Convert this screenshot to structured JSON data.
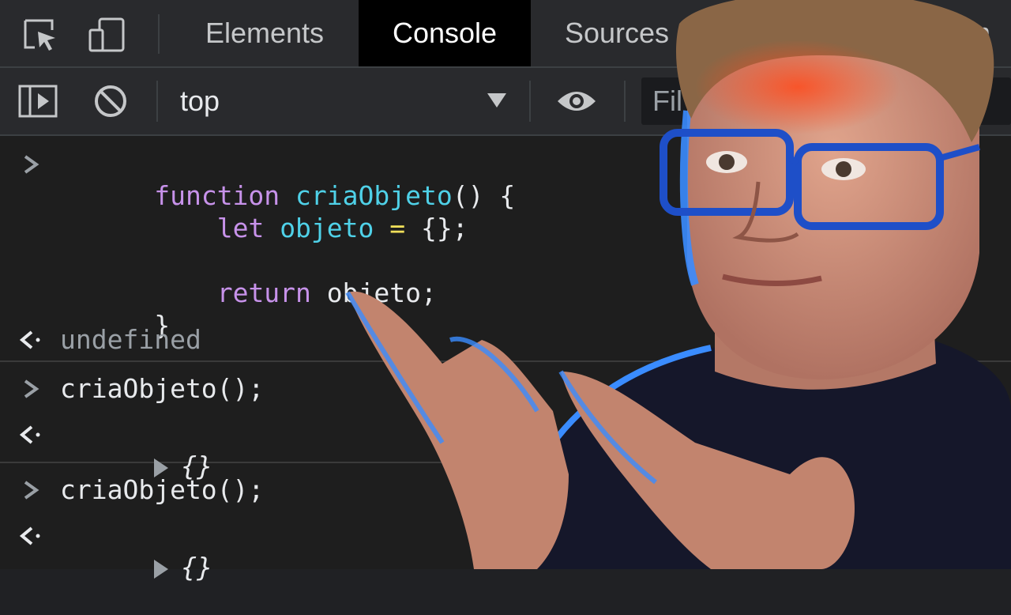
{
  "tabs": [
    {
      "label": "Elements"
    },
    {
      "label": "Console",
      "active": true
    },
    {
      "label": "Sources"
    },
    {
      "label": "rm"
    }
  ],
  "toolbar": {
    "context": "top",
    "filter_placeholder": "Fil"
  },
  "console": {
    "entries": [
      {
        "type": "input",
        "lines": [
          [
            {
              "t": "kw",
              "v": "function"
            },
            {
              "t": "pun",
              "v": " "
            },
            {
              "t": "fn",
              "v": "criaObjeto"
            },
            {
              "t": "pun",
              "v": "() {"
            }
          ],
          [
            {
              "t": "pun",
              "v": "    "
            },
            {
              "t": "kw",
              "v": "let"
            },
            {
              "t": "pun",
              "v": " "
            },
            {
              "t": "var",
              "v": "objeto"
            },
            {
              "t": "pun",
              "v": " "
            },
            {
              "t": "op",
              "v": "="
            },
            {
              "t": "pun",
              "v": " {};"
            }
          ],
          [],
          [
            {
              "t": "pun",
              "v": "    "
            },
            {
              "t": "kw",
              "v": "return"
            },
            {
              "t": "pun",
              "v": " objeto;"
            }
          ],
          [
            {
              "t": "pun",
              "v": "}"
            }
          ]
        ]
      },
      {
        "type": "output",
        "text": "undefined"
      },
      {
        "type": "input_single",
        "text": "criaObjeto();"
      },
      {
        "type": "output_obj",
        "text": "{}"
      },
      {
        "type": "input_single",
        "text": "criaObjeto();"
      },
      {
        "type": "output_obj",
        "text": "{}"
      }
    ]
  },
  "icons": [
    "inspect-element-icon",
    "device-toolbar-icon",
    "sidebar-toggle-icon",
    "clear-console-icon",
    "dropdown-caret-icon",
    "live-expression-eye-icon",
    "prompt-chevron-icon",
    "result-arrow-icon"
  ],
  "colors": {
    "keyword": "#c792ea",
    "identifier": "#4fd1e8",
    "operator": "#f1e05a",
    "muted": "#9aa0a6"
  }
}
